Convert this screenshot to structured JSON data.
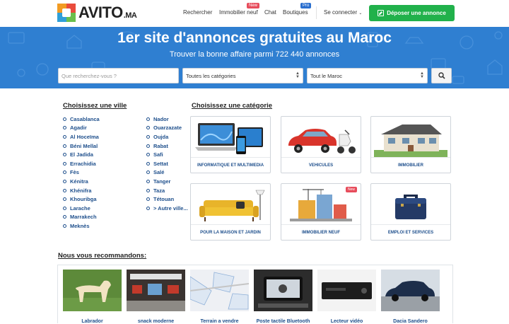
{
  "header": {
    "logo_text": "AVITO",
    "logo_suffix": ".MA",
    "nav": [
      {
        "label": "Rechercher",
        "badge": ""
      },
      {
        "label": "Immobilier neuf",
        "badge": "New"
      },
      {
        "label": "Chat",
        "badge": ""
      },
      {
        "label": "Boutiques",
        "badge": "Pro"
      }
    ],
    "connect_label": "Se connecter",
    "post_label": "Déposer une annonce"
  },
  "hero": {
    "title": "1er site d'annonces gratuites au Maroc",
    "subtitle": "Trouver la bonne affaire parmi 722 440 annonces",
    "search_placeholder": "Que recherchez-vous ?",
    "category_select": "Toutes les catégories",
    "region_select": "Tout le Maroc"
  },
  "cities": {
    "heading": "Choisissez une ville",
    "col1": [
      "Casablanca",
      "Agadir",
      "Al Hoceïma",
      "Béni Mellal",
      "El Jadida",
      "Errachidia",
      "Fès",
      "Kénitra",
      "Khénifra",
      "Khouribga",
      "Larache",
      "Marrakech",
      "Meknès"
    ],
    "col2": [
      "Nador",
      "Ouarzazate",
      "Oujda",
      "Rabat",
      "Safi",
      "Settat",
      "Salé",
      "Tanger",
      "Taza",
      "Tétouan",
      "> Autre ville..."
    ]
  },
  "categories": {
    "heading": "Choisissez une catégorie",
    "items": [
      {
        "label": "INFORMATIQUE ET MULTIMEDIA",
        "badge": ""
      },
      {
        "label": "VEHICULES",
        "badge": ""
      },
      {
        "label": "IMMOBILIER",
        "badge": ""
      },
      {
        "label": "POUR LA MAISON ET JARDIN",
        "badge": ""
      },
      {
        "label": "IMMOBILIER NEUF",
        "badge": "New"
      },
      {
        "label": "EMPLOI ET SERVICES",
        "badge": ""
      }
    ]
  },
  "recommend": {
    "heading": "Nous vous recommandons:",
    "items": [
      "Labrador",
      "snack moderne",
      "Terrain a vendre",
      "Poste tactile Bluetooth",
      "Lecteur vidéo",
      "Dacia Sandero"
    ]
  },
  "colors": {
    "brand_blue": "#2f7fd1",
    "post_green": "#21b14b",
    "link_blue": "#1e4f8c",
    "badge_red": "#e74c5b",
    "badge_pro": "#2a6fcf"
  }
}
